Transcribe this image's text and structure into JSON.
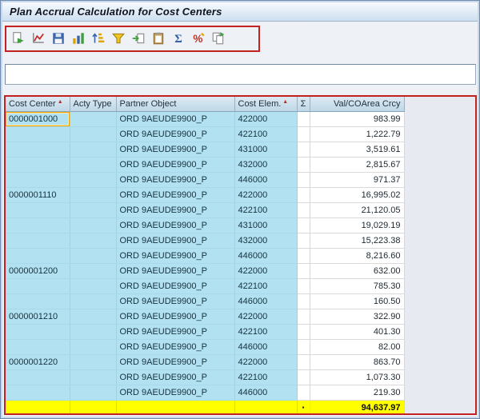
{
  "window": {
    "title": "Plan Accrual Calculation for Cost Centers"
  },
  "toolbar": {
    "icons": [
      {
        "name": "choose-detail-icon"
      },
      {
        "name": "chart-icon"
      },
      {
        "name": "save-icon"
      },
      {
        "name": "column-layout-icon"
      },
      {
        "name": "sort-ascending-icon"
      },
      {
        "name": "filter-icon"
      },
      {
        "name": "export-icon"
      },
      {
        "name": "clipboard-icon"
      },
      {
        "name": "sum-icon",
        "glyph": "Σ"
      },
      {
        "name": "percent-icon",
        "glyph": "%"
      },
      {
        "name": "copy-icon"
      }
    ]
  },
  "selection_field": {
    "value": ""
  },
  "table": {
    "columns": [
      {
        "label": "Cost Center",
        "sorted": true
      },
      {
        "label": "Acty Type",
        "sorted": false
      },
      {
        "label": "Partner Object",
        "sorted": false
      },
      {
        "label": "Cost Elem.",
        "sorted": true
      },
      {
        "label": "Σ",
        "sorted": false
      },
      {
        "label": "Val/COArea Crcy",
        "sorted": false
      }
    ],
    "rows": [
      {
        "cost_center": "0000001000",
        "acty_type": "",
        "partner_object": "ORD 9AEUDE9900_P",
        "cost_elem": "422000",
        "value": "983.99"
      },
      {
        "cost_center": "",
        "acty_type": "",
        "partner_object": "ORD 9AEUDE9900_P",
        "cost_elem": "422100",
        "value": "1,222.79"
      },
      {
        "cost_center": "",
        "acty_type": "",
        "partner_object": "ORD 9AEUDE9900_P",
        "cost_elem": "431000",
        "value": "3,519.61"
      },
      {
        "cost_center": "",
        "acty_type": "",
        "partner_object": "ORD 9AEUDE9900_P",
        "cost_elem": "432000",
        "value": "2,815.67"
      },
      {
        "cost_center": "",
        "acty_type": "",
        "partner_object": "ORD 9AEUDE9900_P",
        "cost_elem": "446000",
        "value": "971.37"
      },
      {
        "cost_center": "0000001110",
        "acty_type": "",
        "partner_object": "ORD 9AEUDE9900_P",
        "cost_elem": "422000",
        "value": "16,995.02"
      },
      {
        "cost_center": "",
        "acty_type": "",
        "partner_object": "ORD 9AEUDE9900_P",
        "cost_elem": "422100",
        "value": "21,120.05"
      },
      {
        "cost_center": "",
        "acty_type": "",
        "partner_object": "ORD 9AEUDE9900_P",
        "cost_elem": "431000",
        "value": "19,029.19"
      },
      {
        "cost_center": "",
        "acty_type": "",
        "partner_object": "ORD 9AEUDE9900_P",
        "cost_elem": "432000",
        "value": "15,223.38"
      },
      {
        "cost_center": "",
        "acty_type": "",
        "partner_object": "ORD 9AEUDE9900_P",
        "cost_elem": "446000",
        "value": "8,216.60"
      },
      {
        "cost_center": "0000001200",
        "acty_type": "",
        "partner_object": "ORD 9AEUDE9900_P",
        "cost_elem": "422000",
        "value": "632.00"
      },
      {
        "cost_center": "",
        "acty_type": "",
        "partner_object": "ORD 9AEUDE9900_P",
        "cost_elem": "422100",
        "value": "785.30"
      },
      {
        "cost_center": "",
        "acty_type": "",
        "partner_object": "ORD 9AEUDE9900_P",
        "cost_elem": "446000",
        "value": "160.50"
      },
      {
        "cost_center": "0000001210",
        "acty_type": "",
        "partner_object": "ORD 9AEUDE9900_P",
        "cost_elem": "422000",
        "value": "322.90"
      },
      {
        "cost_center": "",
        "acty_type": "",
        "partner_object": "ORD 9AEUDE9900_P",
        "cost_elem": "422100",
        "value": "401.30"
      },
      {
        "cost_center": "",
        "acty_type": "",
        "partner_object": "ORD 9AEUDE9900_P",
        "cost_elem": "446000",
        "value": "82.00"
      },
      {
        "cost_center": "0000001220",
        "acty_type": "",
        "partner_object": "ORD 9AEUDE9900_P",
        "cost_elem": "422000",
        "value": "863.70"
      },
      {
        "cost_center": "",
        "acty_type": "",
        "partner_object": "ORD 9AEUDE9900_P",
        "cost_elem": "422100",
        "value": "1,073.30"
      },
      {
        "cost_center": "",
        "acty_type": "",
        "partner_object": "ORD 9AEUDE9900_P",
        "cost_elem": "446000",
        "value": "219.30"
      }
    ],
    "total": {
      "marker": "▪",
      "value": "94,637.97"
    }
  },
  "colors": {
    "annotation_border": "#c22222",
    "cell_cyan": "#b2e1f1",
    "total_yellow": "#ffff00",
    "header_blue": "#c9dcea"
  }
}
